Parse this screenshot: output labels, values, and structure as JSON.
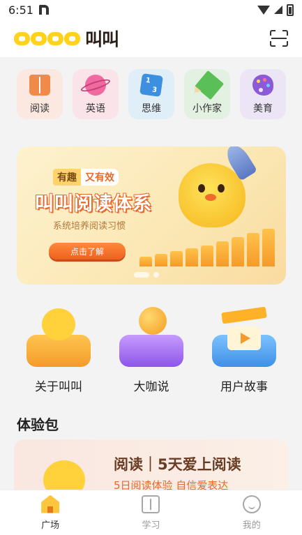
{
  "status_bar": {
    "time": "6:51"
  },
  "header": {
    "brand": "叫叫"
  },
  "categories": [
    {
      "label": "阅读",
      "icon": "book-icon"
    },
    {
      "label": "英语",
      "icon": "planet-icon"
    },
    {
      "label": "思维",
      "icon": "cube-icon"
    },
    {
      "label": "小作家",
      "icon": "pencil-icon"
    },
    {
      "label": "美育",
      "icon": "palette-icon"
    }
  ],
  "banner": {
    "tag_left": "有趣",
    "tag_right": "又有效",
    "title": "叫叫阅读体系",
    "subtitle": "系统培养阅读习惯",
    "cta": "点击了解",
    "active_slide": 1,
    "slide_count": 2
  },
  "features": [
    {
      "label": "关于叫叫",
      "icon": "chick-icon"
    },
    {
      "label": "大咖说",
      "icon": "microphone-icon"
    },
    {
      "label": "用户故事",
      "icon": "clapperboard-icon"
    }
  ],
  "trial_section": {
    "title": "体验包",
    "card": {
      "headline": "阅读｜5天爱上阅读",
      "description": "5日阅读体验 自信爱表达"
    }
  },
  "bottom_nav": [
    {
      "label": "广场",
      "icon": "home-icon",
      "active": true
    },
    {
      "label": "学习",
      "icon": "book-icon",
      "active": false
    },
    {
      "label": "我的",
      "icon": "smile-icon",
      "active": false
    }
  ]
}
